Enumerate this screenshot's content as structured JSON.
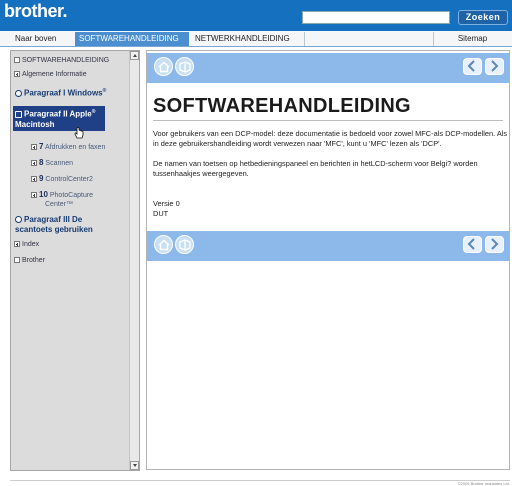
{
  "header": {
    "brand": "brother.",
    "search_value": "",
    "search_button": "Zoeken"
  },
  "tabs": {
    "top": "Naar boven",
    "software": "SOFTWAREHANDLEIDING",
    "network": "NETWERKHANDLEIDING",
    "sitemap": "Sitemap"
  },
  "sidebar": {
    "root": "SOFTWAREHANDLEIDING",
    "general": "Algemene Informatie",
    "part1": "Paragraaf I Windows",
    "part1_sup": "®",
    "part2_a": "Paragraaf II Apple",
    "part2_sup": "®",
    "part2_b": "Macintosh",
    "sub": [
      {
        "num": "7",
        "label": "Afdrukken en faxen"
      },
      {
        "num": "8",
        "label": "Scannen"
      },
      {
        "num": "9",
        "label": "ControlCenter2"
      },
      {
        "num": "10",
        "label": "PhotoCapture",
        "label2": "Center™"
      }
    ],
    "part3_a": "Paragraaf III De",
    "part3_b": "scantoets gebruiken",
    "index": "Index",
    "brother": "Brother"
  },
  "main": {
    "title": "SOFTWAREHANDLEIDING",
    "p1": "Voor gebruikers van een DCP-model: deze documentatie is bedoeld voor zowel MFC-als DCP-modellen. Als in deze gebruikershandleiding wordt verwezen naar 'MFC', kunt u 'MFC' lezen als 'DCP'.",
    "p2": "De namen van toetsen op hetbedieningspaneel en berichten in hetLCD-scherm voor Belgi? worden tussenhaakjes weergegeven.",
    "version": "Versie 0",
    "lang": "DUT"
  },
  "footer": {
    "copyright": "©2009 Brother Industries Ltd."
  },
  "colors": {
    "header_blue": "#1570c0",
    "nav_blue": "#8cb9ea",
    "active_tab": "#4c8fd0",
    "selected_nav": "#1f3f86"
  }
}
